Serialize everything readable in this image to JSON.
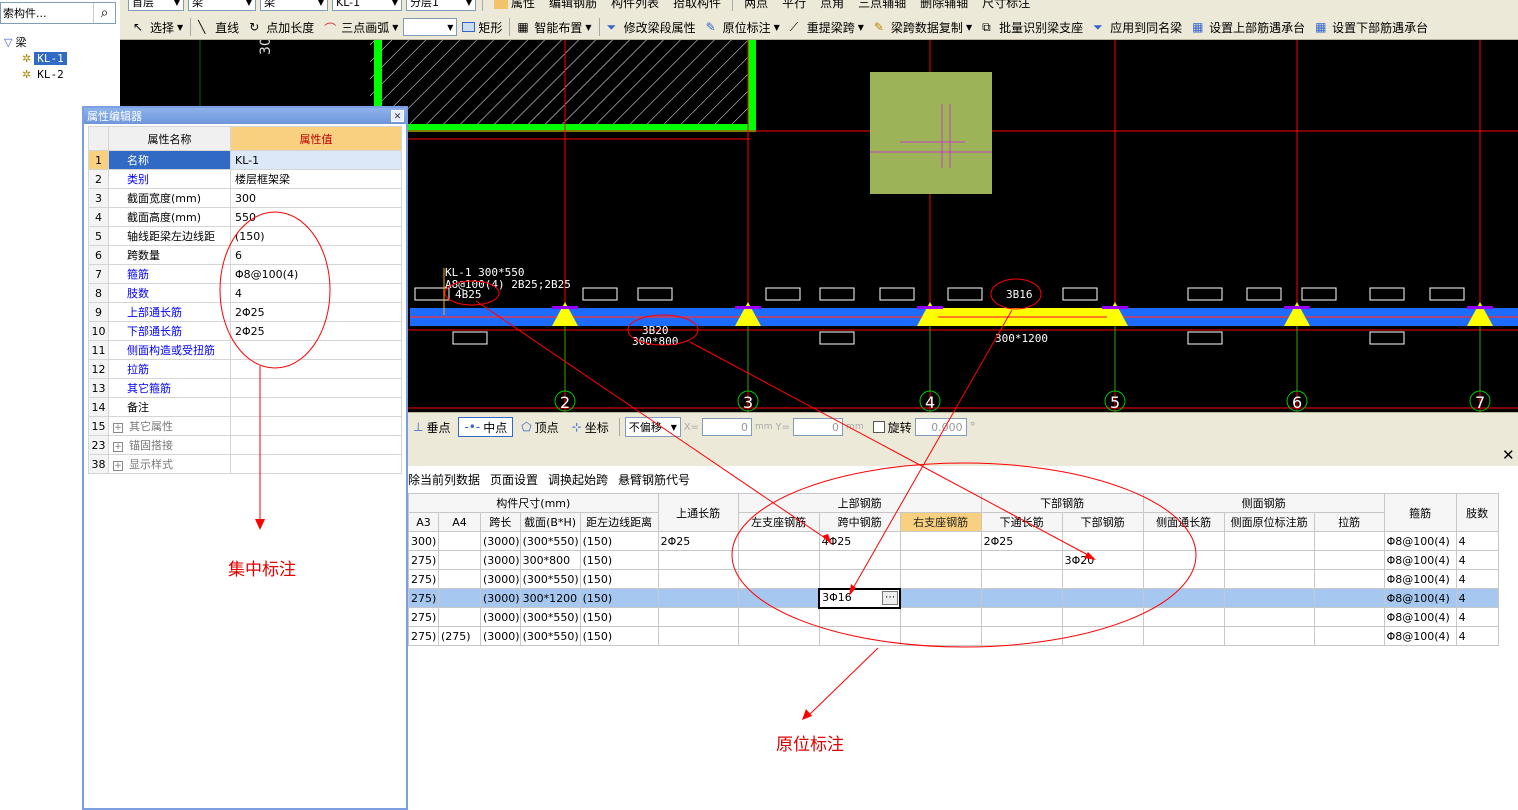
{
  "toolbar1": {
    "floor": "首层",
    "type": "梁",
    "subtype": "梁",
    "element": "KL-1",
    "layer": "分层1",
    "btns": [
      "属性",
      "编辑钢筋",
      "构件列表",
      "拾取构件",
      "两点",
      "平行",
      "点角",
      "三点辅轴",
      "删除辅轴",
      "尺寸标注"
    ]
  },
  "toolbar2": {
    "select": "选择",
    "line": "直线",
    "point_len": "点加长度",
    "arc": "三点画弧",
    "rect": "矩形",
    "smart": "智能布置",
    "modify_seg": "修改梁段属性",
    "orig_mark": "原位标注",
    "re_span": "重提梁跨",
    "copy_span": "梁跨数据复制",
    "batch": "批量识别梁支座",
    "apply_same": "应用到同名梁",
    "top_cap": "设置上部筋遇承台",
    "bot_cap": "设置下部筋遇承台"
  },
  "tree": {
    "search_placeholder": "索构件...",
    "root": "梁",
    "items": [
      "KL-1",
      "KL-2"
    ]
  },
  "prop_editor": {
    "title": "属性编辑器",
    "col_name": "属性名称",
    "col_value": "属性值",
    "rows": [
      {
        "n": "1",
        "name": "名称",
        "val": "KL-1"
      },
      {
        "n": "2",
        "name": "类别",
        "val": "楼层框架梁"
      },
      {
        "n": "3",
        "name": "截面宽度(mm)",
        "val": "300"
      },
      {
        "n": "4",
        "name": "截面高度(mm)",
        "val": "550"
      },
      {
        "n": "5",
        "name": "轴线距梁左边线距",
        "val": "(150)"
      },
      {
        "n": "6",
        "name": "跨数量",
        "val": "6"
      },
      {
        "n": "7",
        "name": "箍筋",
        "val": "Φ8@100(4)"
      },
      {
        "n": "8",
        "name": "肢数",
        "val": "4"
      },
      {
        "n": "9",
        "name": "上部通长筋",
        "val": "2Φ25"
      },
      {
        "n": "10",
        "name": "下部通长筋",
        "val": "2Φ25"
      },
      {
        "n": "11",
        "name": "侧面构造或受扭筋",
        "val": ""
      },
      {
        "n": "12",
        "name": "拉筋",
        "val": ""
      },
      {
        "n": "13",
        "name": "其它箍筋",
        "val": ""
      },
      {
        "n": "14",
        "name": "备注",
        "val": ""
      },
      {
        "n": "15",
        "name": "其它属性",
        "val": ""
      },
      {
        "n": "23",
        "name": "锚固搭接",
        "val": ""
      },
      {
        "n": "38",
        "name": "显示样式",
        "val": ""
      }
    ]
  },
  "cad": {
    "beam_label1": "KL-1 300*550",
    "beam_label2": "A8@100(4) 2B25;2B25",
    "beam_label3": "4B25",
    "mark_3b16": "3B16",
    "mark_3b20": "3B20",
    "sec_300_800": "300*800",
    "sec_300_1200": "300*1200",
    "axis_numbers": [
      "2",
      "3",
      "4",
      "5",
      "6",
      "7"
    ],
    "axis_top_text": "30"
  },
  "snapbar": {
    "perp": "垂点",
    "mid": "中点",
    "vertex": "顶点",
    "coord": "坐标",
    "offset": "不偏移",
    "x_label": "X=",
    "x_val": "0",
    "y_label": "Y=",
    "y_val": "0",
    "unit": "mm",
    "rotate": "旋转",
    "rot_val": "0.000"
  },
  "grid_toolbar": [
    "除当前列数据",
    "页面设置",
    "调换起始跨",
    "悬臂钢筋代号"
  ],
  "grid": {
    "h_size": "构件尺寸(mm)",
    "h_top_long": "上通长筋",
    "h_top_bar": "上部钢筋",
    "h_bot_bar": "下部钢筋",
    "h_side_bar": "侧面钢筋",
    "h_stirrup": "箍筋",
    "h_legs": "肢数",
    "sub": [
      "A3",
      "A4",
      "跨长",
      "截面(B*H)",
      "距左边线距离",
      "左支座钢筋",
      "跨中钢筋",
      "右支座钢筋",
      "下通长筋",
      "下部钢筋",
      "侧面通长筋",
      "侧面原位标注筋",
      "拉筋"
    ],
    "rows": [
      [
        "300)",
        "",
        "(3000)",
        "(300*550)",
        "(150)",
        "2Φ25",
        "",
        "4Φ25",
        "",
        "2Φ25",
        "",
        "",
        "",
        "",
        "Φ8@100(4)",
        "4"
      ],
      [
        "275)",
        "",
        "(3000)",
        "300*800",
        "(150)",
        "",
        "",
        "",
        "",
        "",
        "3Φ20",
        "",
        "",
        "",
        "Φ8@100(4)",
        "4"
      ],
      [
        "275)",
        "",
        "(3000)",
        "(300*550)",
        "(150)",
        "",
        "",
        "",
        "",
        "",
        "",
        "",
        "",
        "",
        "Φ8@100(4)",
        "4"
      ],
      [
        "275)",
        "",
        "(3000)",
        "300*1200",
        "(150)",
        "",
        "",
        "3Φ16",
        "",
        "",
        "",
        "",
        "",
        "",
        "Φ8@100(4)",
        "4"
      ],
      [
        "275)",
        "",
        "(3000)",
        "(300*550)",
        "(150)",
        "",
        "",
        "",
        "",
        "",
        "",
        "",
        "",
        "",
        "Φ8@100(4)",
        "4"
      ],
      [
        "275)",
        "(275)",
        "(3000)",
        "(300*550)",
        "(150)",
        "",
        "",
        "",
        "",
        "",
        "",
        "",
        "",
        "",
        "Φ8@100(4)",
        "4"
      ]
    ]
  },
  "annotations": {
    "concentrated": "集中标注",
    "in_situ": "原位标注"
  }
}
